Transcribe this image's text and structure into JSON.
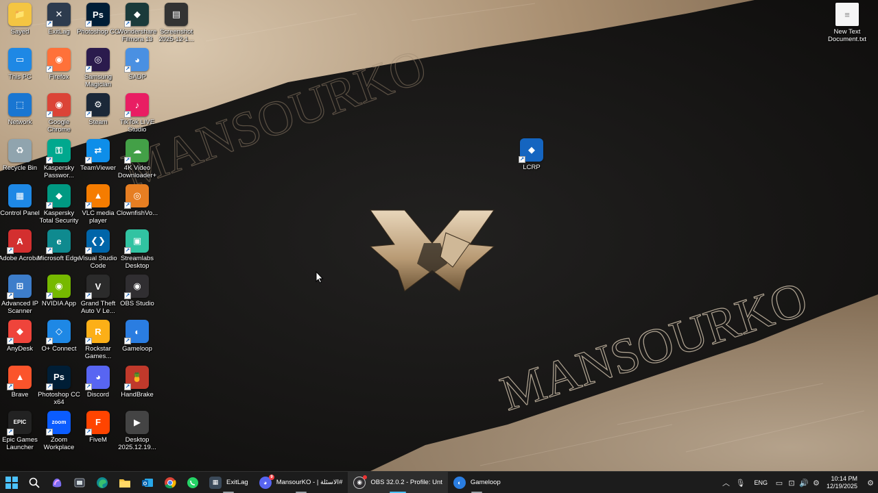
{
  "colors": {
    "taskbar": "#1c1c1c",
    "accent": "#4cc2ff",
    "wallpaper_dark": "#141312",
    "wallpaper_light": "#b59d80"
  },
  "wallpaper": {
    "watermark_top": "MANSOURKO",
    "watermark_bottom": "MANSOURKO"
  },
  "desktop_icons": [
    {
      "label": "Sayed",
      "icon": "folder-icon"
    },
    {
      "label": "ExitLag",
      "icon": "exitlag-icon"
    },
    {
      "label": "Photoshop CC",
      "icon": "photoshop-icon"
    },
    {
      "label": "Wondershare Filmora 13",
      "icon": "filmora-icon"
    },
    {
      "label": "Screenshot 2025-12-1...",
      "icon": "screenshot-file-icon"
    },
    {
      "label": "This PC",
      "icon": "this-pc-icon"
    },
    {
      "label": "Firefox",
      "icon": "firefox-icon"
    },
    {
      "label": "Samsung Magician",
      "icon": "samsung-magician-icon"
    },
    {
      "label": "SADP",
      "icon": "sadp-icon"
    },
    {
      "label": "Network",
      "icon": "network-icon"
    },
    {
      "label": "Google Chrome",
      "icon": "chrome-icon"
    },
    {
      "label": "Steam",
      "icon": "steam-icon"
    },
    {
      "label": "TikTok LIVE Studio",
      "icon": "tiktok-icon"
    },
    {
      "label": "Recycle Bin",
      "icon": "recycle-bin-icon"
    },
    {
      "label": "Kaspersky Passwor...",
      "icon": "kaspersky-password-icon"
    },
    {
      "label": "TeamViewer",
      "icon": "teamviewer-icon"
    },
    {
      "label": "4K Video Downloader+",
      "icon": "4k-downloader-icon"
    },
    {
      "label": "Control Panel",
      "icon": "control-panel-icon"
    },
    {
      "label": "Kaspersky Total Security",
      "icon": "kaspersky-icon"
    },
    {
      "label": "VLC media player",
      "icon": "vlc-icon"
    },
    {
      "label": "ClownfishVo...",
      "icon": "clownfish-icon"
    },
    {
      "label": "Adobe Acrobat",
      "icon": "acrobat-icon"
    },
    {
      "label": "Microsoft Edge",
      "icon": "edge-icon"
    },
    {
      "label": "Visual Studio Code",
      "icon": "vscode-icon"
    },
    {
      "label": "Streamlabs Desktop",
      "icon": "streamlabs-icon"
    },
    {
      "label": "Advanced IP Scanner",
      "icon": "ip-scanner-icon"
    },
    {
      "label": "NVIDIA App",
      "icon": "nvidia-icon"
    },
    {
      "label": "Grand Theft Auto V Le...",
      "icon": "gta-icon"
    },
    {
      "label": "OBS Studio",
      "icon": "obs-icon"
    },
    {
      "label": "AnyDesk",
      "icon": "anydesk-icon"
    },
    {
      "label": "O+ Connect",
      "icon": "oconnect-icon"
    },
    {
      "label": "Rockstar Games...",
      "icon": "rockstar-icon"
    },
    {
      "label": "Gameloop",
      "icon": "gameloop-icon"
    },
    {
      "label": "Brave",
      "icon": "brave-icon"
    },
    {
      "label": "Photoshop CC x64",
      "icon": "photoshop-icon"
    },
    {
      "label": "Discord",
      "icon": "discord-icon"
    },
    {
      "label": "HandBrake",
      "icon": "handbrake-icon"
    },
    {
      "label": "Epic Games Launcher",
      "icon": "epic-games-icon"
    },
    {
      "label": "Zoom Workplace",
      "icon": "zoom-icon"
    },
    {
      "label": "FiveM",
      "icon": "fivem-icon"
    },
    {
      "label": "Desktop 2025.12.19...",
      "icon": "video-file-icon"
    },
    {
      "label": "LCRP",
      "icon": "lcrp-icon"
    },
    {
      "label": "New Text Document.txt",
      "icon": "text-file-icon"
    }
  ],
  "taskbar": {
    "apps": [
      {
        "label": "ExitLag",
        "icon": "exitlag-icon",
        "state": "running"
      },
      {
        "label": "MansourKO - | الاسئلة#",
        "icon": "discord-icon",
        "state": "running",
        "badge": "9"
      },
      {
        "label": "OBS 32.0.2 - Profile: Unt",
        "icon": "obs-icon",
        "state": "active"
      },
      {
        "label": "Gameloop",
        "icon": "gameloop-icon",
        "state": "running"
      }
    ],
    "pinned": [
      "start-icon",
      "search-icon",
      "copilot-icon",
      "app-icon",
      "edge-icon",
      "file-explorer-icon",
      "outlook-icon",
      "chrome-icon",
      "whatsapp-icon"
    ],
    "tray": {
      "language": "ENG",
      "time": "10:14 PM",
      "date": "12/19/2025"
    }
  }
}
